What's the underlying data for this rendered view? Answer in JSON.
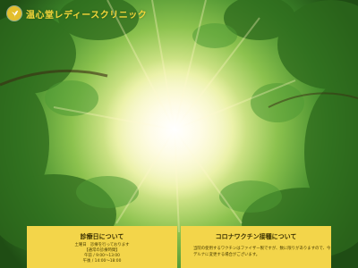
{
  "site": {
    "brand_name": "温心堂レディースクリニック",
    "logo_icon": "plant-leaf-icon"
  },
  "hero": {
    "image_description_icon": "sunlight-through-trees-image"
  },
  "panels": {
    "clinic_days": {
      "title": "診療日について",
      "lines": [
        "土曜日　診療を行っております",
        "【通常の診療時間】",
        "午前 / 9:00〜13:00",
        "午後 / 14:00〜18:00"
      ]
    },
    "vaccination": {
      "title": "コロナワクチン接種について",
      "lines": [
        "当院の使用するワクチンはファイザー製ですが、数に限りがありますので、今",
        "デルナに変更する場合がございます。"
      ]
    }
  },
  "colors": {
    "brand_yellow": "#f4d63a",
    "panel_yellow": "#f3d54a",
    "foliage_green": "#2f6e1f"
  }
}
